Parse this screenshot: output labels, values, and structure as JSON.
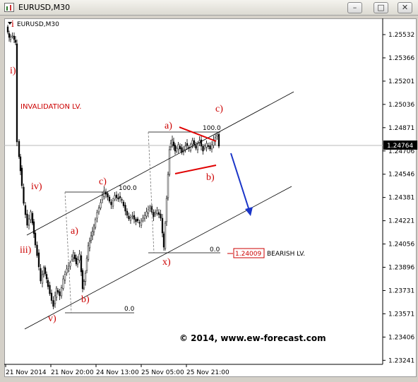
{
  "window": {
    "title": "EURUSD,M30",
    "buttons": [
      "minimize",
      "restore",
      "close"
    ]
  },
  "chart": {
    "symbol_label": "EURUSD,M30"
  },
  "chart_data": {
    "type": "candlestick",
    "symbol": "EURUSD",
    "timeframe": "M30",
    "y_ticks": [
      "1.25532",
      "1.25366",
      "1.25201",
      "1.25036",
      "1.24871",
      "1.24706",
      "1.24546",
      "1.24381",
      "1.24221",
      "1.24056",
      "1.23896",
      "1.23731",
      "1.23571",
      "1.23406",
      "1.23241"
    ],
    "current_price": "1.24764",
    "x_ticks": [
      "21 Nov 2014",
      "21 Nov 20:00",
      "24 Nov 13:00",
      "25 Nov 05:00",
      "25 Nov 21:00"
    ],
    "ylim": [
      1.2322,
      1.2562
    ]
  },
  "annotations": {
    "invalidation": "INVALIDATION LV.",
    "bearish": "BEARISH LV.",
    "bearish_value": "1.24009",
    "copyright": "© 2014, www.ew-forecast.com",
    "wave_labels": [
      "i",
      "i)",
      "iv)",
      "iii)",
      "v)",
      "a)",
      "b)",
      "c)",
      "x)",
      "a)",
      "b)",
      "c)"
    ],
    "levels": [
      "100.0",
      "0.0",
      "100.0",
      "0.0"
    ]
  },
  "colors": {
    "label": "#cc0000",
    "arrow": "#1a35c8",
    "triangle": "#e00000",
    "price_box": "#000000"
  }
}
